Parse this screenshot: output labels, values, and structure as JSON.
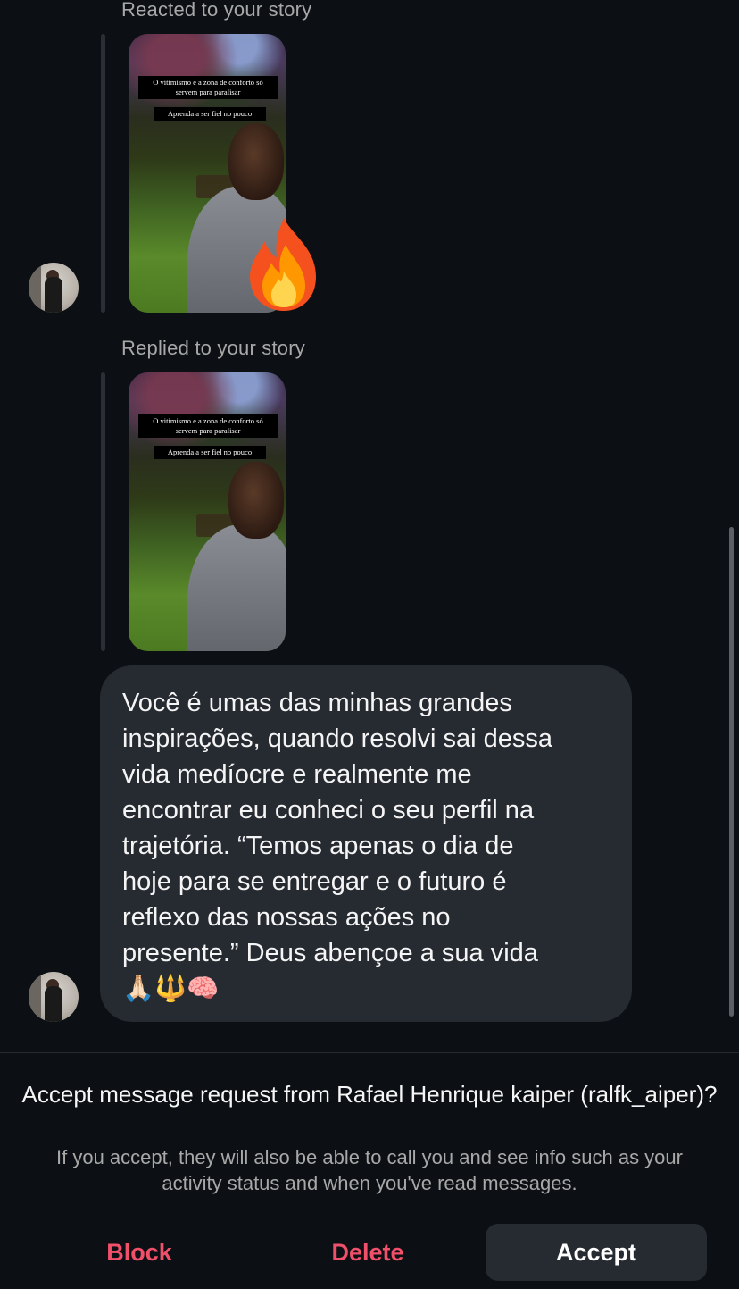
{
  "thread": {
    "story_reaction": {
      "context_label": "Reacted to your story",
      "caption_main": "O vitimismo e a zona de conforto só servem para paralisar",
      "caption_sub": "Aprenda a ser fiel no pouco",
      "reaction_emoji_icon": "fire-emoji"
    },
    "story_reply": {
      "context_label": "Replied to your story",
      "caption_main": "O vitimismo e a zona de conforto só servem para paralisar",
      "caption_sub": "Aprenda a ser fiel no pouco"
    },
    "message": {
      "text": "Você é umas das minhas grandes\ninspirações, quando resolvi sai dessa\nvida medíocre e realmente me\nencontrar eu conheci o seu perfil na\ntrajetória. “Temos apenas o dia de\nhoje para se entregar e o futuro é\nreflexo das nossas ações no\npresente.” Deus abençoe a sua vida\n🙏🏻🔱🧠"
    }
  },
  "request": {
    "title": "Accept message request from Rafael Henrique kaiper (ralfk_aiper)?",
    "subtitle": "If you accept, they will also be able to call you and see info such as your activity status and when you've read messages."
  },
  "actions": {
    "block_label": "Block",
    "delete_label": "Delete",
    "accept_label": "Accept"
  },
  "colors": {
    "background": "#0c1014",
    "bubble": "#262a31",
    "destructive": "#f0506a",
    "secondary_text": "#a8a8a8"
  }
}
